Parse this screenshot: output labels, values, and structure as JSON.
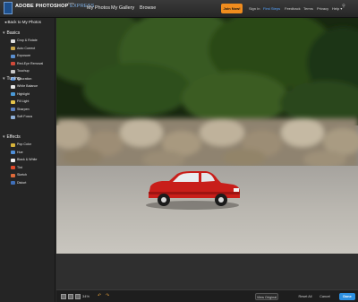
{
  "app": {
    "brand": "ADOBE",
    "product": "PHOTOSHOP",
    "edition": "EXPRESS",
    "badge": "beta"
  },
  "nav": {
    "items": [
      "My Photos",
      "My Gallery",
      "Browse"
    ]
  },
  "top_links": {
    "join": "Join Now!",
    "sign_in": "Sign In",
    "first_steps": "First Steps",
    "feedback": "Feedback",
    "terms": "Terms",
    "privacy": "Privacy",
    "help": "Help"
  },
  "sidebar": {
    "back": "Back to My Photos",
    "sections": [
      {
        "title": "Basics",
        "tools": [
          {
            "label": "Crop & Rotate",
            "icon": "crop-icon",
            "color": "#e0e0e0"
          },
          {
            "label": "Auto Correct",
            "icon": "auto-correct-icon",
            "color": "#c9a64a"
          },
          {
            "label": "Exposure",
            "icon": "exposure-icon",
            "color": "#5a8fd0"
          },
          {
            "label": "Red-Eye Removal",
            "icon": "red-eye-icon",
            "color": "#d04a3a"
          },
          {
            "label": "Touchup",
            "icon": "touchup-icon",
            "color": "#c9c9c9"
          },
          {
            "label": "Saturation",
            "icon": "saturation-icon",
            "color": "#3f7fd0"
          }
        ]
      },
      {
        "title": "Tuning",
        "tools": [
          {
            "label": "White Balance",
            "icon": "white-balance-icon",
            "color": "#e6e6e6"
          },
          {
            "label": "Highlight",
            "icon": "highlight-icon",
            "color": "#4a9ad8"
          },
          {
            "label": "Fill Light",
            "icon": "fill-light-icon",
            "color": "#e6c44a"
          },
          {
            "label": "Sharpen",
            "icon": "sharpen-icon",
            "color": "#5a7fbf"
          },
          {
            "label": "Soft Focus",
            "icon": "soft-focus-icon",
            "color": "#8fb0d8"
          }
        ]
      },
      {
        "title": "Effects",
        "tools": [
          {
            "label": "Pop Color",
            "icon": "pop-color-icon",
            "color": "#d7b33a"
          },
          {
            "label": "Hue",
            "icon": "hue-icon",
            "color": "#4f8fd8"
          },
          {
            "label": "Black & White",
            "icon": "black-white-icon",
            "color": "#f0f0f0"
          },
          {
            "label": "Tint",
            "icon": "tint-icon",
            "color": "#e34a2a"
          },
          {
            "label": "Sketch",
            "icon": "sketch-icon",
            "color": "#e06a3a"
          },
          {
            "label": "Distort",
            "icon": "distort-icon",
            "color": "#3f6fb8"
          }
        ]
      }
    ]
  },
  "bottom": {
    "zoom": "34%",
    "view_original": "View Original",
    "reset_all": "Reset All",
    "cancel": "Cancel",
    "done": "Done"
  },
  "colors": {
    "accent_blue": "#2d8fe0",
    "join_orange": "#f08c1e",
    "undo_orange": "#e29e3a"
  }
}
